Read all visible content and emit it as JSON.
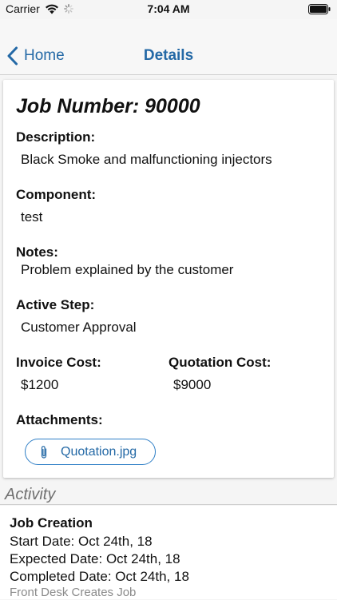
{
  "status_bar": {
    "carrier": "Carrier",
    "time": "7:04 AM"
  },
  "nav": {
    "back_label": "Home",
    "title": "Details"
  },
  "card": {
    "job_title": "Job Number: 90000",
    "description": {
      "label": "Description:",
      "value": "Black Smoke and malfunctioning injectors"
    },
    "component": {
      "label": "Component:",
      "value": "test"
    },
    "notes": {
      "label": "Notes:",
      "value": "Problem explained by the customer"
    },
    "active_step": {
      "label": "Active Step:",
      "value": "Customer Approval"
    },
    "invoice_cost": {
      "label": "Invoice Cost:",
      "value": "$1200"
    },
    "quotation_cost": {
      "label": "Quotation Cost:",
      "value": "$9000"
    },
    "attachments": {
      "label": "Attachments:",
      "items": [
        "Quotation.jpg"
      ]
    }
  },
  "activity": {
    "header": "Activity",
    "items": [
      {
        "title": "Job Creation",
        "start_date": "Start Date: Oct 24th, 18",
        "expected_date": "Expected Date: Oct 24th, 18",
        "completed_date": "Completed Date: Oct 24th, 18",
        "note": "Front Desk Creates Job"
      }
    ]
  },
  "colors": {
    "accent": "#2469a6",
    "background": "#f5f5f5",
    "card": "#ffffff",
    "muted": "#8a8a8a"
  },
  "icons": [
    "wifi-icon",
    "activity-spinner-icon",
    "battery-icon",
    "chevron-left-icon",
    "paperclip-icon"
  ]
}
